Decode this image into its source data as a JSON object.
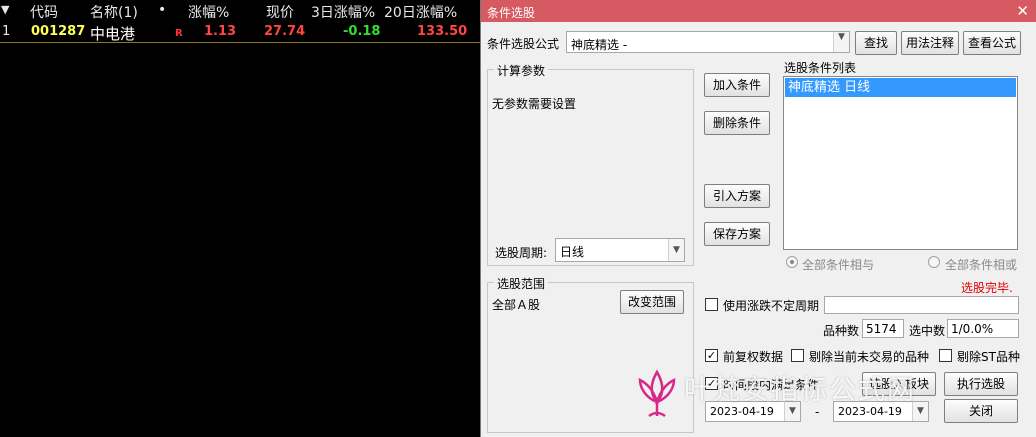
{
  "grid": {
    "headers": {
      "index_marker": "▼",
      "code": "代码",
      "name": "名称(1)",
      "dot": "•",
      "change_pct": "涨幅%",
      "price": "现价",
      "change3d": "3日涨幅%",
      "change20d": "20日涨幅%"
    },
    "rows": [
      {
        "index": "1",
        "code": "001287",
        "name": "中电港",
        "tag": "R",
        "change_pct": "1.13",
        "price": "27.74",
        "change3d": "-0.18",
        "change20d": "133.50"
      }
    ]
  },
  "dialog": {
    "title": "条件选股",
    "close_glyph": "✕",
    "formula_label": "条件选股公式",
    "formula_value": "神底精选    -",
    "find_button": "查找",
    "usage_button": "用法注释",
    "view_formula_button": "查看公式",
    "params_group": "计算参数",
    "params_text": "无参数需要设置",
    "period_label": "选股周期:",
    "period_value": "日线",
    "add_condition": "加入条件",
    "delete_condition": "删除条件",
    "import_plan": "引入方案",
    "save_plan": "保存方案",
    "list_title": "选股条件列表",
    "list_items": [
      "神底精选  日线"
    ],
    "radio_and": "全部条件相与",
    "radio_or": "全部条件相或",
    "status": "选股完毕.",
    "range_group": "选股范围",
    "range_value": "全部Ａ股",
    "change_range": "改变范围",
    "use_cycle": "使用涨跌不定周期",
    "count_label": "品种数",
    "count_value": "5174",
    "selected_label": "选中数",
    "selected_value": "1/0.0%",
    "fq_label": "前复权数据",
    "exclude_untraded": "剔除当前未交易的品种",
    "exclude_st": "剔除ST品种",
    "time_range": "时间段内满足条件",
    "to_block": "选股入板块",
    "execute": "执行选股",
    "date_from": "2023-04-19",
    "date_sep": "-",
    "date_to": "2023-04-19",
    "close_button": "关闭"
  },
  "watermark": {
    "text": "叶梵安指标公式网"
  },
  "colors": {
    "titlebar": "#d65a62",
    "status_red": "#e00000",
    "list_selection": "#3399ff",
    "stock_up": "#ff4444",
    "stock_down": "#33dd33",
    "stock_code": "#ffff55"
  }
}
